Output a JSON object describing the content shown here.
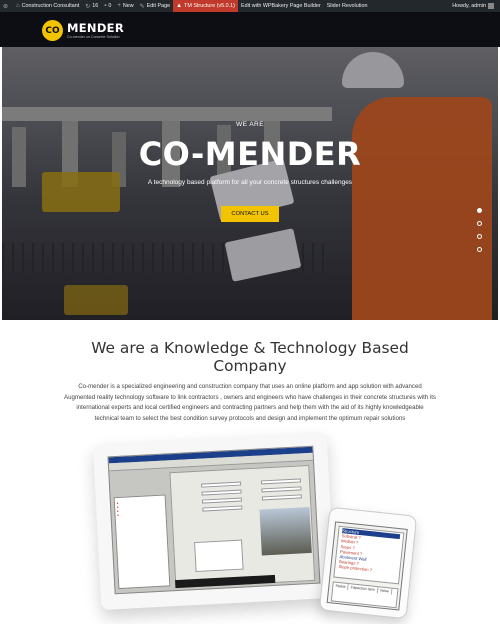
{
  "admin_bar": {
    "site_name": "Construction Consultant",
    "updates_count": "16",
    "comments_count": "0",
    "new_label": "New",
    "edit_page": "Edit Page",
    "tm_structure": "TM Structure (v5.0.1)",
    "wpbakery": "Edit with WPBakery Page Builder",
    "slider": "Slider Revolution",
    "howdy": "Howdy, admin"
  },
  "header": {
    "logo_mark": "CO",
    "logo_name": "MENDER",
    "logo_tagline": "Co-mender on Concrete Solution"
  },
  "hero": {
    "pretitle": "WE ARE",
    "title": "CO-MENDER",
    "subtitle": "A technology based platform for all your concrete structures challenges",
    "cta": "CONTACT US",
    "slides_count": 4,
    "active_slide": 1
  },
  "about": {
    "title": "We are a Knowledge & Technology Based Company",
    "body": "Co-mender is a specialized engineering and construction company that uses an online platform and app solution with advanced Augmented reality technology software to link contractors , owners and engineers who have challenges in their concrete structures with its international experts and local certified engineers and contracting partners and help them with the aid of its highly knowledgeable technical team to select the best condition survey protocols and design and implement the optimum repair solutions"
  },
  "phone_app": {
    "list_items": [
      "Structure",
      "Substrat ?",
      "Median ?",
      "Steps ?",
      "Pavement ?",
      "Abutment Wall",
      "Bearings ?",
      "Slope protection ?"
    ],
    "table_headers": [
      "Status",
      "Inspection Item",
      "Value"
    ]
  },
  "colors": {
    "accent": "#f2c300",
    "header_bg": "#0d0d14",
    "admin_bar_bg": "#23282d",
    "tm_highlight": "#c0392b"
  }
}
